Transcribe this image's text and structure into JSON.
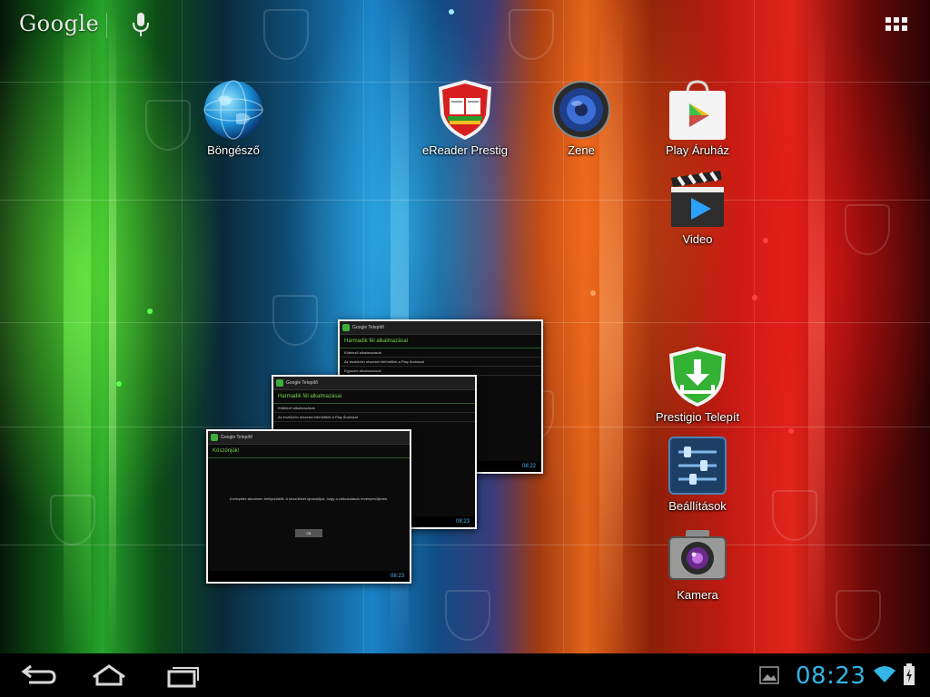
{
  "header": {
    "search_logo": "Google",
    "voice_icon": "microphone-icon",
    "apps_icon": "all-apps-grid-icon"
  },
  "apps": [
    {
      "label": "Böngésző",
      "icon": "globe-browser-icon"
    },
    {
      "label": "eReader Prestig",
      "icon": "ereader-book-shield-icon"
    },
    {
      "label": "Zene",
      "icon": "speaker-music-icon"
    },
    {
      "label": "Play Áruház",
      "icon": "play-store-bag-icon"
    },
    {
      "label": "Video",
      "icon": "clapperboard-video-icon"
    },
    {
      "label": "Prestigio Telepít",
      "icon": "download-shield-icon"
    },
    {
      "label": "Beállítások",
      "icon": "settings-sliders-icon"
    },
    {
      "label": "Kamera",
      "icon": "camera-icon"
    }
  ],
  "recents": [
    {
      "app_title": "Google Telepítő",
      "heading": "Harmadik fél alkalmazásai",
      "lines": [
        "Kötelező alkalmazások",
        "Az eszközön részesei elérhetőek a Play Áruházat",
        "Egyszeri alkalmazások"
      ],
      "time": "08:22"
    },
    {
      "app_title": "Google Telepítő",
      "heading": "Harmadik fél alkalmazásai",
      "lines": [
        "Kötelező alkalmazások",
        "Az eszközön részesei elérhetőek a Play Áruházat"
      ],
      "time": "08:23"
    },
    {
      "app_title": "Google Telepítő",
      "heading": "Köszönjük!",
      "lines": [
        "A telepítés sikeresen befejeződött. A készüléket újraindítjuk, hogy a változtatások érvényesüljenek."
      ],
      "button": "Ok",
      "time": "08:23"
    }
  ],
  "system_bar": {
    "back_icon": "back-arrow-icon",
    "home_icon": "home-icon",
    "recents_icon": "recent-apps-icon",
    "notification_icon": "picture-notification-icon",
    "time": "08:23",
    "wifi_icon": "wifi-icon",
    "battery_icon": "battery-charging-icon"
  },
  "colors": {
    "clock_blue": "#33b5e5",
    "thumb_green": "#6fd34b"
  }
}
